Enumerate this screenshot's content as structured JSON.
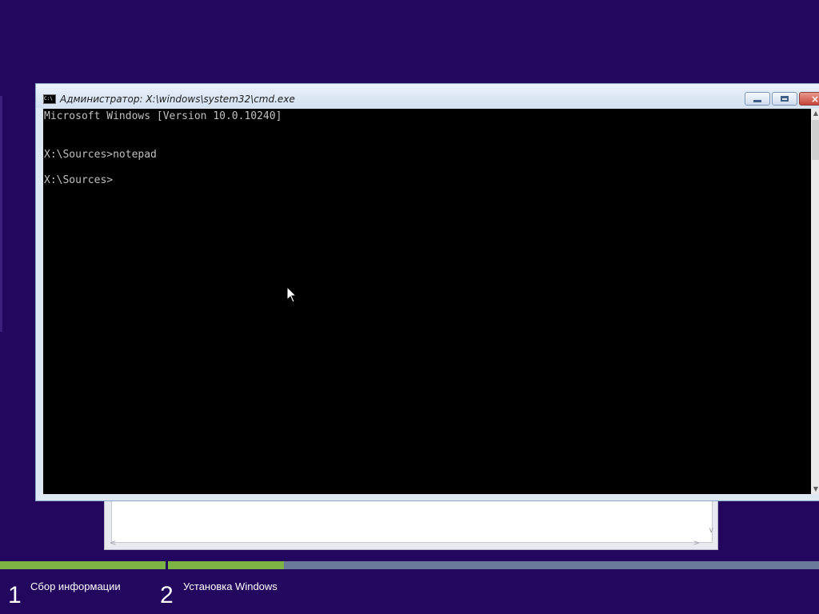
{
  "cmd_window": {
    "title": "Администратор: X:\\windows\\system32\\cmd.exe",
    "icon_text": "C:\\",
    "buttons": {
      "minimize": "minimize-icon",
      "maximize": "maximize-icon",
      "close": "×"
    },
    "console_lines": [
      "Microsoft Windows [Version 10.0.10240]",
      "X:\\Sources>notepad",
      "X:\\Sources>"
    ]
  },
  "setup_progress": {
    "steps": [
      {
        "number": "1",
        "label": "Сбор информации"
      },
      {
        "number": "2",
        "label": "Установка Windows"
      }
    ],
    "colors": {
      "complete": "#7cb342",
      "track": "#6a7a9b",
      "background": "#23075e"
    }
  }
}
